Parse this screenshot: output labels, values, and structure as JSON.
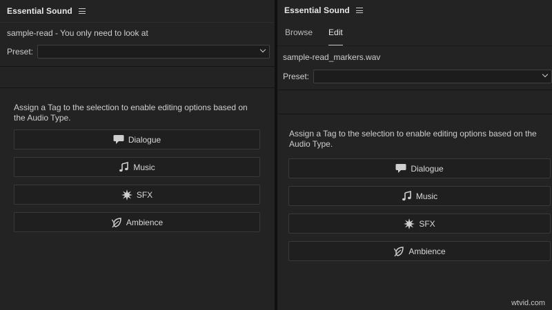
{
  "left": {
    "title": "Essential Sound",
    "clip_name": "sample-read - You only need to look at",
    "preset_label": "Preset:",
    "preset_value": "",
    "assign_text": "Assign a Tag to the selection to enable editing options based on the Audio Type.",
    "buttons": [
      {
        "label": "Dialogue",
        "icon": "speech-bubble-icon"
      },
      {
        "label": "Music",
        "icon": "music-note-icon"
      },
      {
        "label": "SFX",
        "icon": "burst-icon"
      },
      {
        "label": "Ambience",
        "icon": "leaf-icon"
      }
    ]
  },
  "right": {
    "title": "Essential Sound",
    "tabs": [
      {
        "label": "Browse",
        "active": false
      },
      {
        "label": "Edit",
        "active": true
      }
    ],
    "clip_name": "sample-read_markers.wav",
    "preset_label": "Preset:",
    "preset_value": "",
    "assign_text": "Assign a Tag to the selection to enable editing options based on the Audio Type.",
    "buttons": [
      {
        "label": "Dialogue",
        "icon": "speech-bubble-icon"
      },
      {
        "label": "Music",
        "icon": "music-note-icon"
      },
      {
        "label": "SFX",
        "icon": "burst-icon"
      },
      {
        "label": "Ambience",
        "icon": "leaf-icon"
      }
    ]
  },
  "watermark": "wtvid.com"
}
